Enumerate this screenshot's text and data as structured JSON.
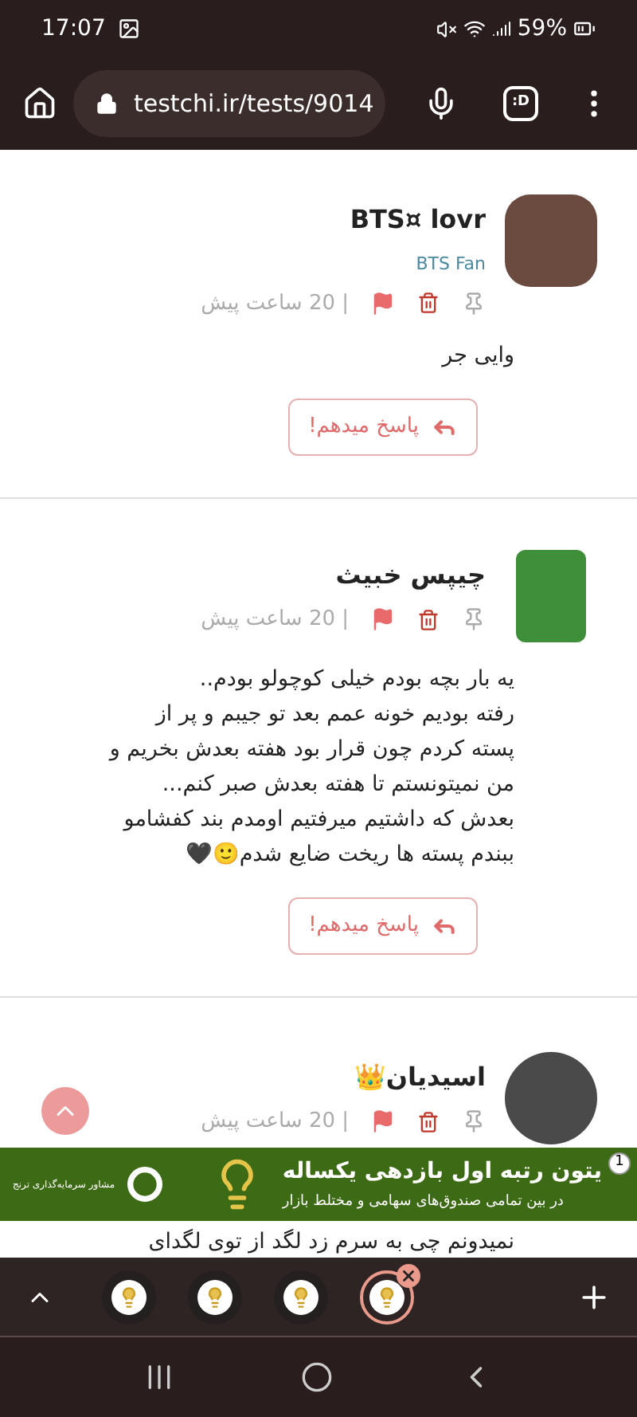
{
  "status_bar": {
    "time": "17:07",
    "battery": "59%"
  },
  "browser": {
    "url": "testchi.ir/tests/9014",
    "tab_switcher": ":D"
  },
  "comments": [
    {
      "name": "BTS¤ lovr",
      "badge": "BTS Fan",
      "kind": "rounded",
      "time": "| 20 ساعت پیش",
      "lines": [
        "وایی جر"
      ],
      "reply": "پاسخ میدهم!"
    },
    {
      "name": "چیپس خبیث",
      "kind": "square",
      "time": "| 20 ساعت پیش",
      "lines": [
        "یه بار بچه بودم خیلی کوچولو بودم..",
        "رفته بودیم خونه عمم بعد تو جیبم و پر از",
        "پسته کردم چون قرار بود هفته بعدش بخریم و",
        "من نمیتونستم تا هفته بعدش صبر کنم...",
        "بعدش که داشتیم میرفتیم اومدم بند کفشامو",
        "ببندم پسته ها ریخت ضایع شدم🙂🖤"
      ],
      "reply": "پاسخ میدهم!"
    },
    {
      "name": "اسیدیان👑",
      "kind": "circle",
      "time": "| 20 ساعت پیش",
      "lines": [
        "نمیدونم چی به سرم زد لگد از توی لگدای"
      ]
    }
  ],
  "ad": {
    "badge": "1",
    "title": "یتون رتبه اول بازدهی یکساله",
    "subtitle": "در بین تمامی صندوق‌های سهامی و مختلط بازار",
    "brand": "مشاور سرمایه‌گذاری ترنج"
  },
  "tabs": [
    {
      "selected": false
    },
    {
      "selected": false
    },
    {
      "selected": false
    },
    {
      "selected": true
    }
  ]
}
